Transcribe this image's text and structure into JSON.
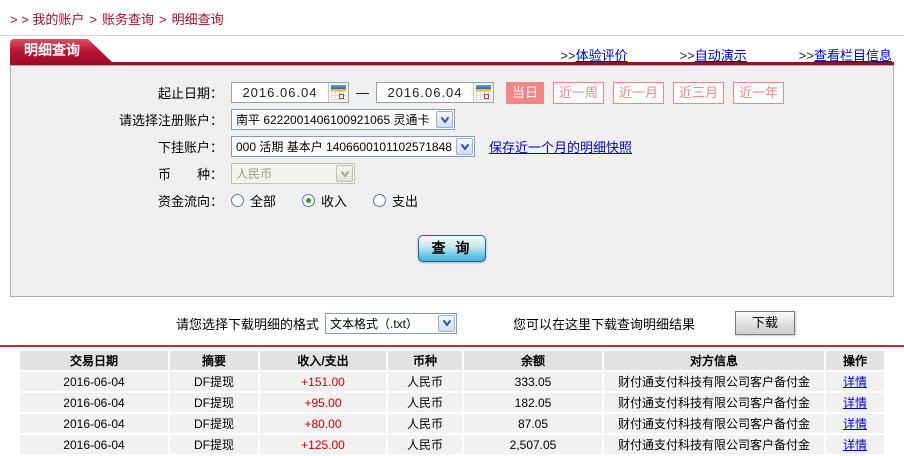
{
  "breadcrumb": {
    "prefix": "> >",
    "separator": ">",
    "items": [
      "我的账户",
      "账务查询",
      "明细查询"
    ]
  },
  "tab_title": "明细查询",
  "header_links": {
    "prefix": ">>",
    "items": [
      "体验评价",
      "自动演示",
      "查看栏目信息"
    ]
  },
  "form": {
    "date_label": "起止日期：",
    "date_from": "2016.06.04",
    "date_to": "2016.06.04",
    "date_separator": "—",
    "quick_ranges": [
      {
        "label": "当日",
        "active": true
      },
      {
        "label": "近一周",
        "active": false
      },
      {
        "label": "近一月",
        "active": false
      },
      {
        "label": "近三月",
        "active": false
      },
      {
        "label": "近一年",
        "active": false
      }
    ],
    "account_label": "请选择注册账户：",
    "account_value": "南平  6222001406100921065  灵通卡",
    "sub_account_label": "下挂账户：",
    "sub_account_value": "000 活期 基本户 1406600101102571848",
    "snapshot_link": "保存近一个月的明细快照",
    "currency_label": "币　　种：",
    "currency_value": "人民币",
    "flow_label": "资金流向：",
    "flow_options": [
      {
        "label": "全部",
        "checked": false
      },
      {
        "label": "收入",
        "checked": true
      },
      {
        "label": "支出",
        "checked": false
      }
    ],
    "query_button": "查 询"
  },
  "download": {
    "format_label": "请您选择下载明细的格式",
    "format_value": "文本格式（.txt）",
    "hint": "您可以在这里下载查询明细结果",
    "button_label": "下载"
  },
  "table": {
    "headers": [
      "交易日期",
      "摘要",
      "收入/支出",
      "币种",
      "余额",
      "对方信息",
      "操作"
    ],
    "rows": [
      {
        "date": "2016-06-04",
        "summary": "DF提现",
        "amount": "+151.00",
        "currency": "人民币",
        "balance": "333.05",
        "counterparty": "财付通支付科技有限公司客户备付金",
        "action": "详情"
      },
      {
        "date": "2016-06-04",
        "summary": "DF提现",
        "amount": "+95.00",
        "currency": "人民币",
        "balance": "182.05",
        "counterparty": "财付通支付科技有限公司客户备付金",
        "action": "详情"
      },
      {
        "date": "2016-06-04",
        "summary": "DF提现",
        "amount": "+80.00",
        "currency": "人民币",
        "balance": "87.05",
        "counterparty": "财付通支付科技有限公司客户备付金",
        "action": "详情"
      },
      {
        "date": "2016-06-04",
        "summary": "DF提现",
        "amount": "+125.00",
        "currency": "人民币",
        "balance": "2,507.05",
        "counterparty": "财付通支付科技有限公司客户备付金",
        "action": "详情"
      }
    ]
  },
  "icons": {
    "date_picker": "calendar-icon",
    "select_arrow": "chevron-down-icon"
  },
  "colors": {
    "crimson": "#aa0c2e",
    "crimson-dark": "#9c0b28",
    "tab-red": "#b8122f",
    "pink": "#f28585",
    "link-blue": "#0000cc",
    "amount-red": "#cc0000",
    "divider-red": "#cc2439",
    "panel-bg": "#f0f0f0",
    "header-bg": "#e2e2e2",
    "row-bg": "#f1f1f1",
    "query-blue": "#49b4dc"
  }
}
